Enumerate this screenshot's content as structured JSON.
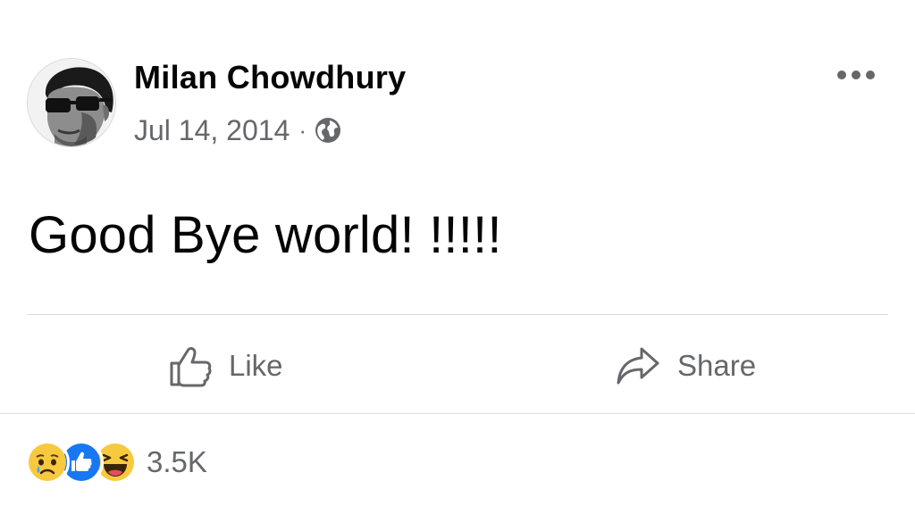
{
  "post": {
    "author": {
      "name": "Milan Chowdhury",
      "avatar_icon": "profile-photo"
    },
    "meta": {
      "date": "Jul 14, 2014",
      "separator": "·",
      "privacy_icon": "globe-icon"
    },
    "more_icon": "more-horizontal-icon",
    "text": "Good Bye world! !!!!!",
    "actions": {
      "like_label": "Like",
      "share_label": "Share"
    },
    "reactions": {
      "types": [
        "sad",
        "like",
        "haha"
      ],
      "count": "3.5K"
    }
  },
  "colors": {
    "text_primary": "#050505",
    "text_secondary": "#65676b",
    "divider": "#dadde1",
    "like_blue": "#1877f2",
    "emoji_yellow": "#f7c93e"
  }
}
